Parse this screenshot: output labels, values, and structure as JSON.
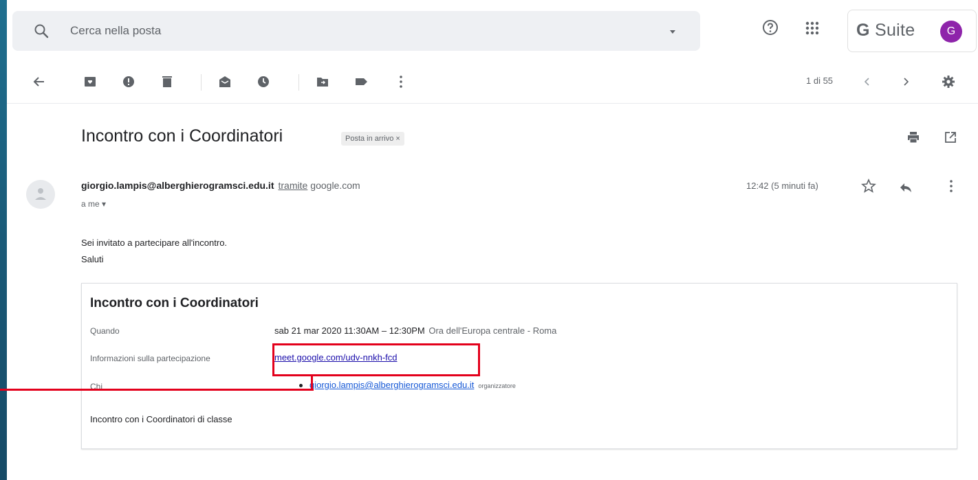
{
  "header": {
    "search_placeholder": "Cerca nella posta",
    "brand_g": "G",
    "brand_suite": "Suite",
    "avatar_letter": "G"
  },
  "toolbar": {
    "pager_text": "1 di 55",
    "icons": [
      "back-arrow-icon",
      "archive-icon",
      "report-spam-icon",
      "delete-icon",
      "mark-unread-icon",
      "snooze-icon",
      "move-to-icon",
      "label-icon",
      "more-vert-icon"
    ]
  },
  "email": {
    "subject": "Incontro con i Coordinatori",
    "label": "Posta in arrivo ×",
    "sender_email": "giorgio.lampis@alberghierogramsci.edu.it",
    "via_text": "tramite",
    "via_domain": "google.com",
    "to_text": "a me ▾",
    "time_text": "12:42 (5 minuti fa)",
    "body_line1": "Sei invitato a partecipare all'incontro.",
    "body_line2": "Saluti"
  },
  "invite": {
    "title": "Incontro con i Coordinatori",
    "when_label": "Quando",
    "when_value": "sab 21 mar 2020 11:30AM – 12:30PM",
    "timezone": "Ora dell'Europa centrale - Roma",
    "join_label": "Informazioni sulla partecipazione",
    "join_link": "meet.google.com/udv-nnkh-fcd",
    "who_label": "Chi",
    "who_email": "giorgio.lampis@alberghierogramsci.edu.it",
    "who_role": "organizzatore",
    "description": "Incontro con i Coordinatori di classe"
  },
  "colors": {
    "accent_red": "#e3001b",
    "avatar_purple": "#8e24aa",
    "link_blue": "#1a0dab"
  }
}
